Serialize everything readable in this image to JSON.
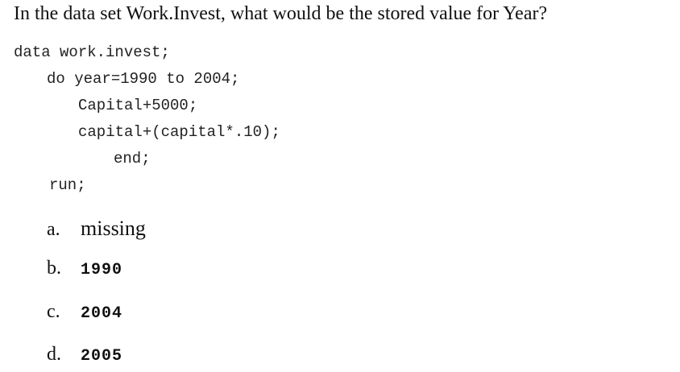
{
  "question": "In the data set Work.Invest, what would be the stored value for Year?",
  "code": [
    "data work.invest;",
    "do year=1990 to 2004;",
    "Capital+5000;",
    "capital+(capital*.10);",
    "end;",
    "run;"
  ],
  "options": [
    {
      "letter": "a.",
      "text": "missing"
    },
    {
      "letter": "b.",
      "text": "1990"
    },
    {
      "letter": "c.",
      "text": "2004"
    },
    {
      "letter": "d.",
      "text": "2005"
    }
  ]
}
